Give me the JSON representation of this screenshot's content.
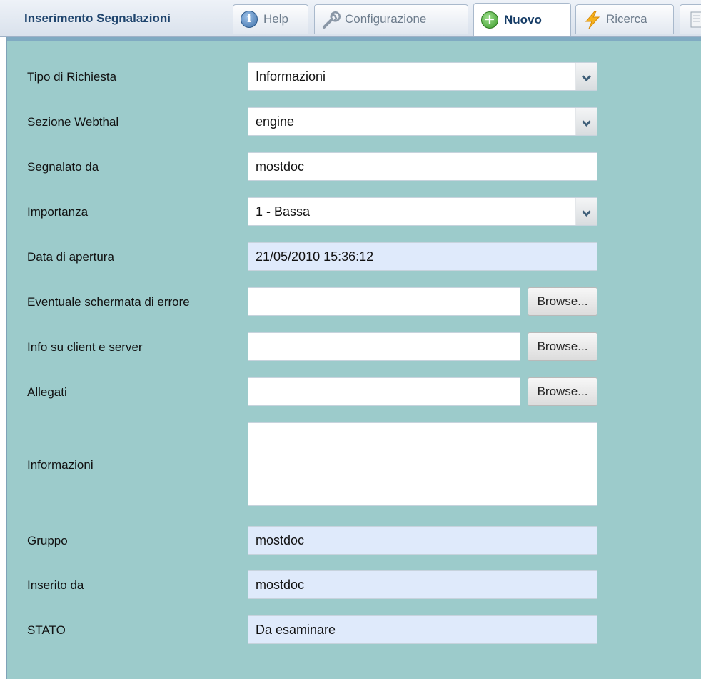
{
  "tabs": {
    "title": "Inserimento Segnalazioni",
    "items": [
      {
        "label": "Help",
        "icon": "info-icon"
      },
      {
        "label": "Configurazione",
        "icon": "wrench-icon"
      },
      {
        "label": "Nuovo",
        "icon": "add-icon",
        "active": true
      },
      {
        "label": "Ricerca",
        "icon": "lightning-icon"
      }
    ]
  },
  "form": {
    "tipo": {
      "label": "Tipo di Richiesta",
      "value": "Informazioni"
    },
    "sezione": {
      "label": "Sezione Webthal",
      "value": "engine"
    },
    "segnalato": {
      "label": "Segnalato da",
      "value": "mostdoc"
    },
    "importanza": {
      "label": "Importanza",
      "value": "1 - Bassa"
    },
    "data": {
      "label": "Data di apertura",
      "value": "21/05/2010 15:36:12"
    },
    "schermata": {
      "label": "Eventuale schermata di errore",
      "value": "",
      "button": "Browse..."
    },
    "info_client": {
      "label": "Info su client e server",
      "value": "",
      "button": "Browse..."
    },
    "allegati": {
      "label": "Allegati",
      "value": "",
      "button": "Browse..."
    },
    "informazioni": {
      "label": "Informazioni",
      "value": ""
    },
    "gruppo": {
      "label": "Gruppo",
      "value": "mostdoc"
    },
    "inserito": {
      "label": "Inserito da",
      "value": "mostdoc"
    },
    "stato": {
      "label": "STATO",
      "value": "Da esaminare"
    }
  },
  "colors": {
    "panel_bg": "#9ccbcb",
    "readonly_bg": "#dfeafb",
    "title_text": "#20456e"
  }
}
